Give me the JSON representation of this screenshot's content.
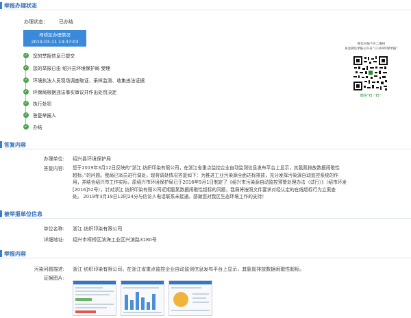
{
  "sections": {
    "status": "举报办理状态",
    "reply": "答复内容",
    "reported": "被举报单位信息",
    "content": "举报内容"
  },
  "status": {
    "label": "办理状态：",
    "value": "已办结",
    "box_title": "柯桥区办理情况",
    "box_time": "2019-03-11 14:37:03",
    "steps": [
      "您的举报信息已提交",
      "您的举报已由 绍兴县环境保护局 受理",
      "环境执法人员现场调查取证、采样监测、收集违法证据",
      "环保局根据违法事实审议并作出处罚决定",
      "执行处罚",
      "答复举报人",
      "办结"
    ]
  },
  "qr": {
    "caption1": "微信扫描下方二维码",
    "caption2": "关注微信举报公众号“12369环保举报”",
    "bottom": "微信“扫一扫”"
  },
  "reply": {
    "unit_label": "办理单位:",
    "unit_value": "绍兴县环境保护局",
    "content_label": "答复内容:",
    "lines": [
      "您于2019年3月12日反映的“浙江    纺织印染有限公司，在浙江省重点监控企业自动监测信息发布平台上显示，其氨氮排放数据闹歌性",
      "超标。”的问题。我局已派员进行调处，现将调处情况答复如下：为推进工业污染源全面达标排放，充分发挥污染源自动监控系统的作",
      "用，并结合绍兴市工作实际，原绍兴市环境保护局已于2016年9月1日制定了《绍兴市污染源自动监控预警处理办法（试行）》（绍市环发",
      "[2016]52号），针对浙江     纺织印染有限公司近期氨氮数据闹歌性超标的问题，我局将按照文件要求对经认定的在线超标行为立案查",
      "处。 2019年3月19日12时24分与信访人电话联系未接通。感谢您对我区生态环境工作的支持！"
    ]
  },
  "reported": {
    "name_label": "单位名称:",
    "name_value": "浙江     纺织印染有限公司",
    "addr_label": "详细地址:",
    "addr_value": "绍兴市柯桥区滨海工业区兴滨路3180号"
  },
  "content": {
    "desc_label": "污染问题描述:",
    "desc_value": "浙江     纺织印染有限公司，在浙江省重点监控企业自动监测信息发布平台上显示，其氨氮排放数据闹歌性超标。",
    "images_label": "证据图片:"
  }
}
